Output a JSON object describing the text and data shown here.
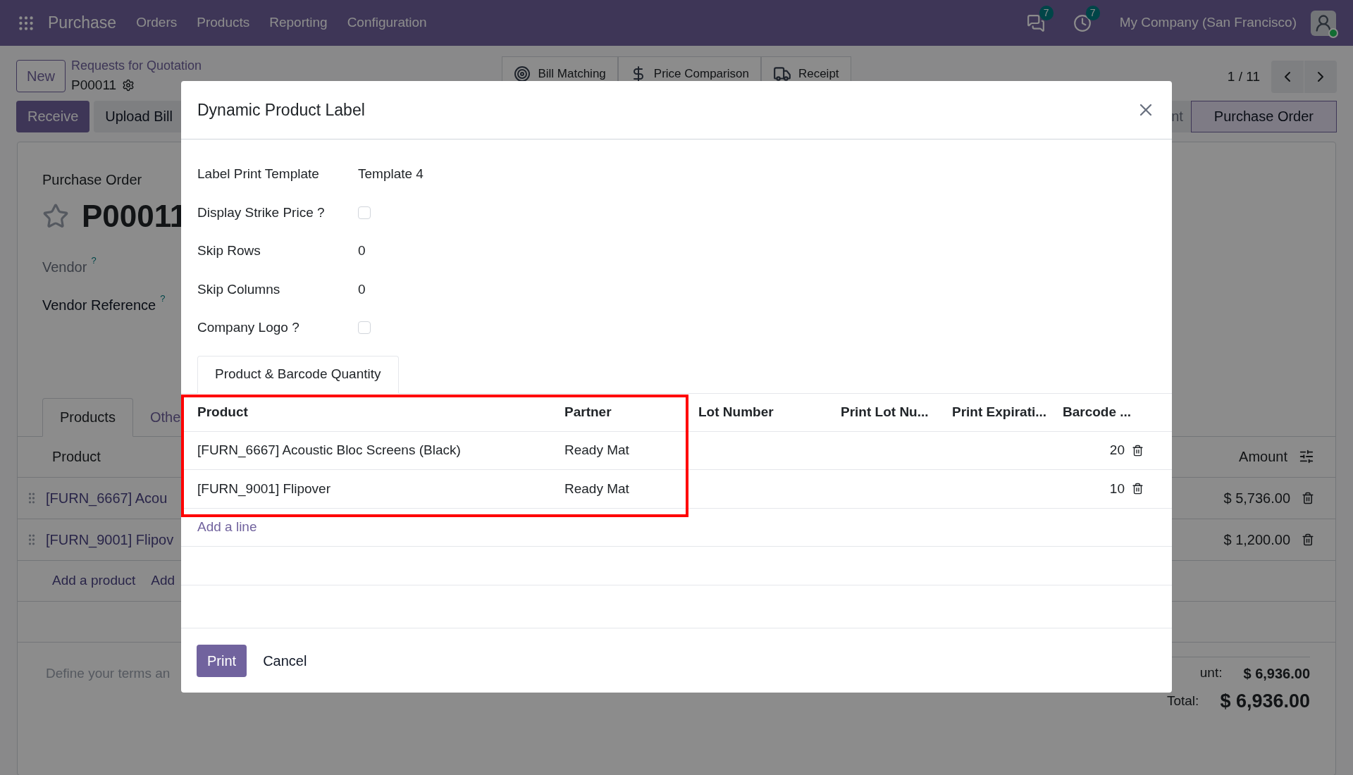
{
  "navbar": {
    "app": "Purchase",
    "menu": [
      "Orders",
      "Products",
      "Reporting",
      "Configuration"
    ],
    "messages_count": "7",
    "activities_count": "7",
    "company": "My Company (San Francisco)"
  },
  "control_panel": {
    "new_button": "New",
    "breadcrumb": "Requests for Quotation",
    "record": "P00011",
    "smart_buttons": [
      {
        "kind": "target",
        "label": "Bill Matching"
      },
      {
        "kind": "dollar",
        "label": "Price Comparison"
      },
      {
        "kind": "truck",
        "label": "Receipt"
      }
    ],
    "pager": "1 / 11"
  },
  "actions": [
    {
      "label": "Receive",
      "primary": true
    },
    {
      "label": "Upload Bill",
      "primary": false
    }
  ],
  "status_bar": [
    {
      "label": "nt",
      "selected": false
    },
    {
      "label": "Purchase Order",
      "selected": true
    }
  ],
  "form": {
    "title_label": "Purchase Order",
    "starred": false,
    "name": "P00011",
    "fields": [
      {
        "label": "Vendor",
        "help": "?",
        "muted": true
      },
      {
        "label": "Vendor Reference",
        "help": "?",
        "muted": false
      }
    ]
  },
  "tabs": [
    {
      "label": "Products",
      "selected": true
    },
    {
      "label": "Othe",
      "selected": false
    }
  ],
  "order_lines": {
    "columns": [
      "Product",
      "Amount"
    ],
    "rows": [
      {
        "product": "[FURN_6667] Acou",
        "amount": "$ 5,736.00"
      },
      {
        "product": "[FURN_9001] Flipov",
        "amount": "$ 1,200.00"
      }
    ],
    "add_links": [
      "Add a product",
      "Add"
    ]
  },
  "terms_placeholder": "Define your terms an",
  "totals": [
    {
      "kind": "untaxed",
      "label": "unt:",
      "value": "$ 6,936.00"
    },
    {
      "kind": "total",
      "label": "Total:",
      "value": "$ 6,936.00"
    }
  ],
  "dialog": {
    "title": "Dynamic Product Label",
    "fields": [
      {
        "kind": "text",
        "label": "Label Print Template",
        "value": "Template 4"
      },
      {
        "kind": "checkbox",
        "label": "Display Strike Price ?",
        "checked": false
      },
      {
        "kind": "text",
        "label": "Skip Rows",
        "value": "0"
      },
      {
        "kind": "text",
        "label": "Skip Columns",
        "value": "0"
      },
      {
        "kind": "checkbox",
        "label": "Company Logo ?",
        "checked": false
      }
    ],
    "tabs": [
      {
        "label": "Product & Barcode Quantity",
        "selected": true
      }
    ],
    "table": {
      "columns": [
        "Product",
        "Partner",
        "Lot Number",
        "Print Lot Nu...",
        "Print Expirati...",
        "Barcode ..."
      ],
      "rows": [
        {
          "product": "[FURN_6667] Acoustic Bloc Screens (Black)",
          "partner": "Ready Mat",
          "barcode_quantity": "20"
        },
        {
          "product": "[FURN_9001] Flipover",
          "partner": "Ready Mat",
          "barcode_quantity": "10"
        }
      ],
      "add_line": "Add a line"
    },
    "buttons": [
      {
        "label": "Print",
        "primary": true
      },
      {
        "label": "Cancel",
        "primary": false
      }
    ]
  }
}
